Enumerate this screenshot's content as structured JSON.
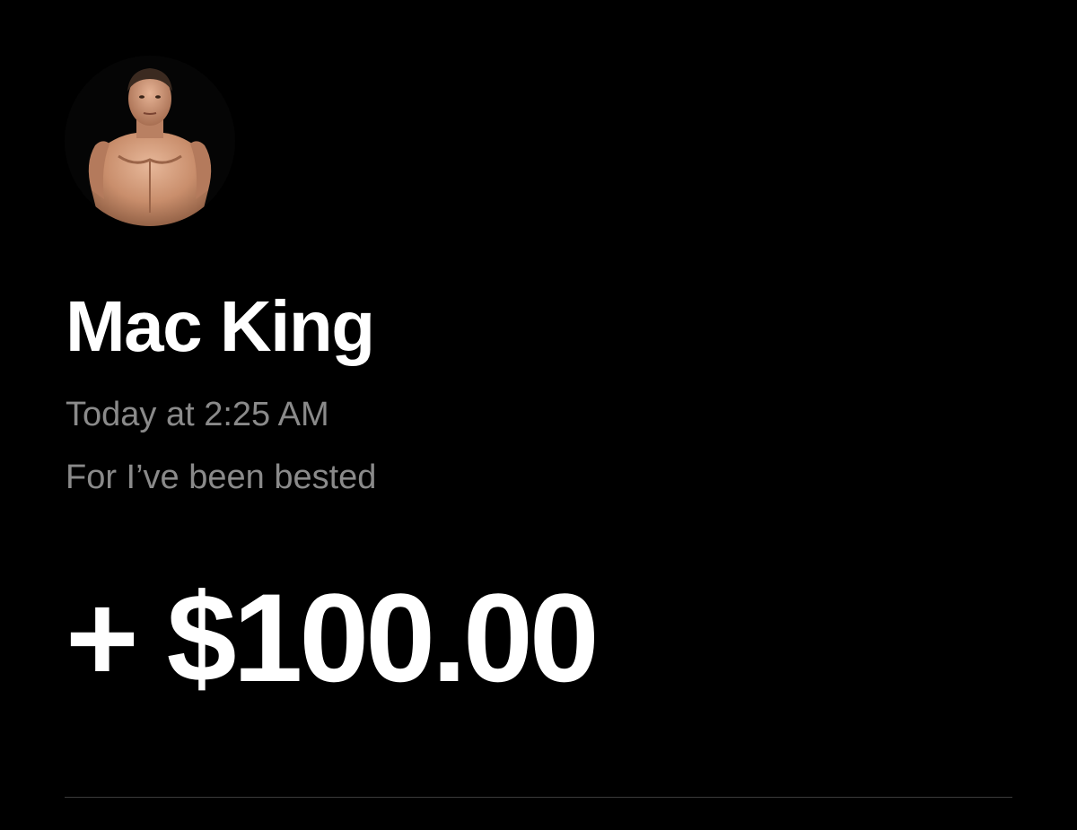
{
  "transaction": {
    "sender_name": "Mac King",
    "timestamp": "Today at 2:25 AM",
    "note": "For I’ve been bested",
    "amount": "+ $100.00"
  },
  "colors": {
    "background": "#000000",
    "primary_text": "#ffffff",
    "secondary_text": "#8a8a8a",
    "divider": "#3a3a3a"
  },
  "icons": {
    "avatar": "profile-photo-avatar"
  }
}
